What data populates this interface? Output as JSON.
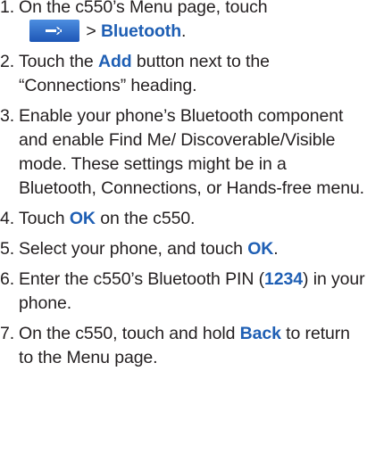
{
  "steps": [
    {
      "num": "1.",
      "pre": "On the c550’s Menu page, touch",
      "button_icon": "wrench-icon",
      "sep": "> ",
      "b1": "Bluetooth",
      "post": "."
    },
    {
      "num": "2.",
      "pre": "Touch the ",
      "b1": "Add",
      "post": " button next to the “Connections” heading."
    },
    {
      "num": "3.",
      "text": "Enable your phone’s Bluetooth component and enable Find Me/ Discoverable/Visible mode. These settings might be in a Bluetooth, Connections, or Hands-free menu."
    },
    {
      "num": "4.",
      "pre": "Touch ",
      "b1": "OK",
      "post": " on the c550."
    },
    {
      "num": "5.",
      "pre": "Select your phone, and touch ",
      "b1": "OK",
      "post": "."
    },
    {
      "num": "6.",
      "pre": "Enter the c550’s Bluetooth PIN (",
      "b1": "1234",
      "post": ") in your phone."
    },
    {
      "num": "7.",
      "pre": "On the c550, touch and hold ",
      "b1": "Back",
      "post": " to return to the Menu page."
    }
  ],
  "colors": {
    "accent": "#1f5fb4",
    "text": "#231f20",
    "button_top": "#4d8ee0",
    "button_bottom": "#1d56b6"
  }
}
